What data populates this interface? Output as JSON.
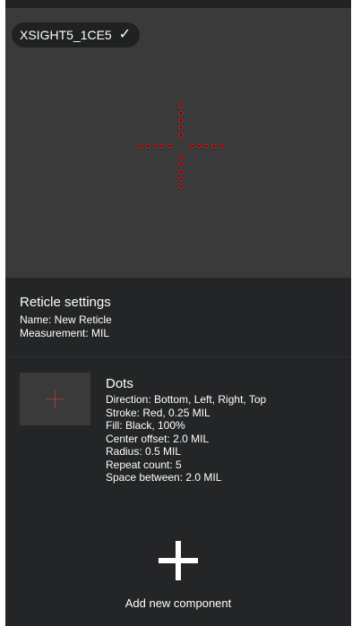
{
  "device": {
    "name": "XSIGHT5_1CE5",
    "status_icon": "check-icon"
  },
  "reticle_settings": {
    "title": "Reticle settings",
    "name_line": "Name: New Reticle",
    "measurement_line": "Measurement: MIL"
  },
  "component": {
    "title": "Dots",
    "lines": [
      "Direction: Bottom, Left, Right, Top",
      "Stroke: Red, 0.25 MIL",
      "Fill: Black, 100%",
      "Center offset: 2.0 MIL",
      "Radius: 0.5 MIL",
      "Repeat count: 5",
      "Space between: 2.0 MIL"
    ]
  },
  "add_component": {
    "label": "Add new component",
    "icon": "plus-icon"
  },
  "colors": {
    "background": "#232527",
    "preview_bg": "#3a3a3a",
    "dot_fill": "#5a0000",
    "dot_stroke": "#d01818",
    "text": "#ffffff"
  }
}
